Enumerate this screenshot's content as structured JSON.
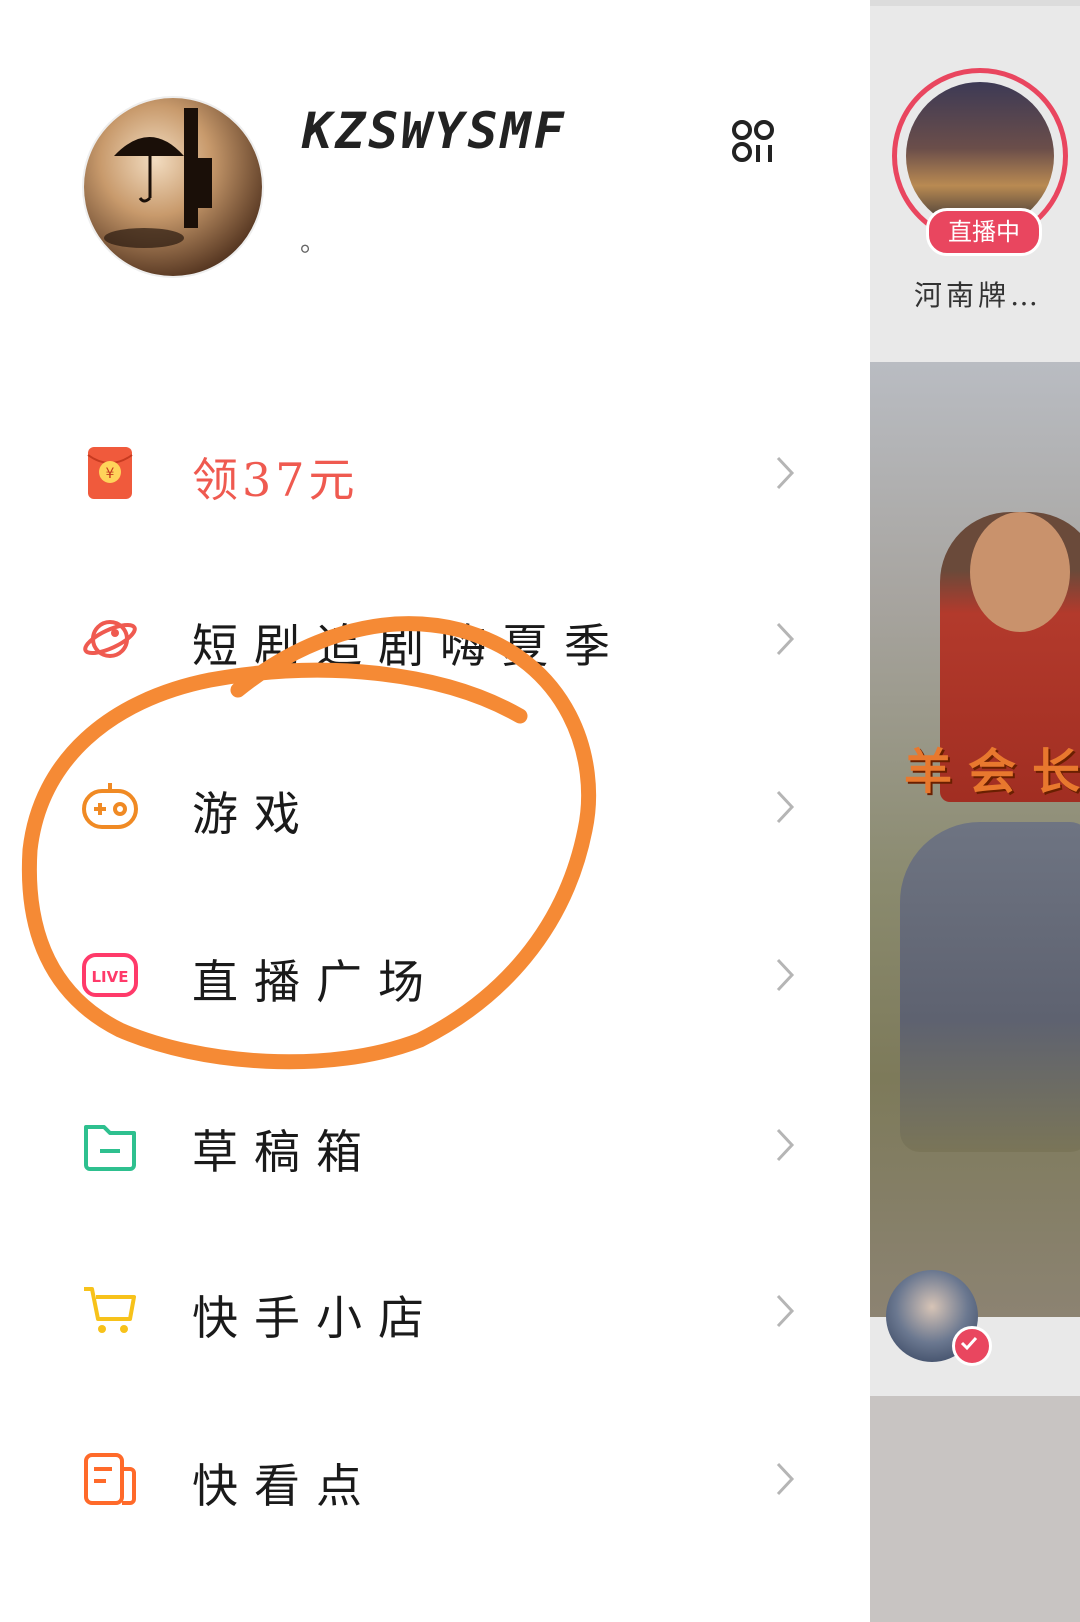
{
  "profile": {
    "name": "KZSWYSMF",
    "bio": "。"
  },
  "menu": [
    {
      "label": "领37元",
      "icon": "red-envelope-icon",
      "color": "#ef5a50"
    },
    {
      "label": "短剧追剧嗨夏季",
      "icon": "planet-icon",
      "color": "#ef5a50"
    },
    {
      "label": "游戏",
      "icon": "gamepad-icon",
      "color": "#f08a24"
    },
    {
      "label": "直播广场",
      "icon": "live-icon",
      "color": "#ff3a6a"
    },
    {
      "label": "草稿箱",
      "icon": "folder-icon",
      "color": "#2ec08f"
    },
    {
      "label": "快手小店",
      "icon": "cart-icon",
      "color": "#f7c21a"
    },
    {
      "label": "快看点",
      "icon": "news-icon",
      "color": "#ff6a2a"
    }
  ],
  "background_feed": {
    "live_badge": "直播中",
    "live_streamer_name": "河南牌…",
    "video_caption": "羊会长"
  },
  "annotation": {
    "color": "#f58a35"
  }
}
